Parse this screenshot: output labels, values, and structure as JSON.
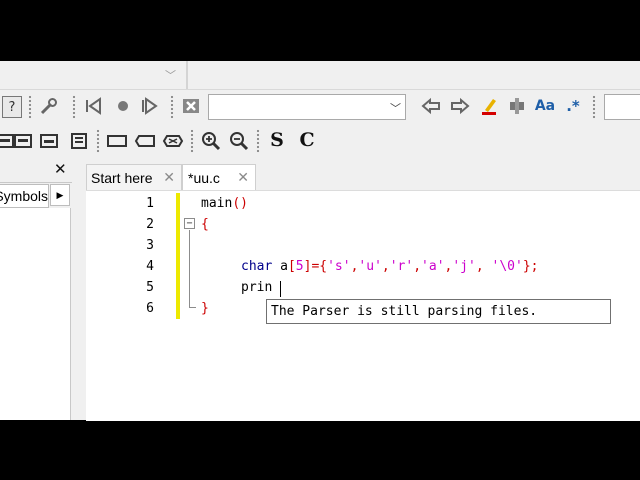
{
  "toolbar": {
    "search_combo_value": "",
    "second_combo_value": "",
    "icons_row1": [
      "help-icon",
      "wrench-icon",
      "prev-bookmark-icon",
      "bookmark-dot-icon",
      "next-bookmark-icon",
      "stop-icon",
      "back-arrow-icon",
      "forward-arrow-icon",
      "highlight-pen-icon",
      "toolbar-tool-icon",
      "match-case-icon",
      "regex-icon"
    ],
    "icons_row2": [
      "block-icon-1",
      "block-icon-2",
      "block-icon-3",
      "block-icon-4",
      "rect-icon-1",
      "rect-icon-2",
      "rect-icon-3",
      "zoom-in-icon",
      "zoom-out-icon",
      "s-icon",
      "c-icon"
    ],
    "match_case_glyph": "Aa",
    "regex_glyph": ".*",
    "s_glyph": "S",
    "c_glyph": "C"
  },
  "left_panel": {
    "close_glyph": "✕",
    "tab_label": "Symbols",
    "scroll_glyph": "▶"
  },
  "tabs": [
    {
      "label": "Start here",
      "close": "✕"
    },
    {
      "label": "*uu.c",
      "close": "✕"
    }
  ],
  "editor": {
    "line_numbers": [
      "1",
      "2",
      "3",
      "4",
      "5",
      "6"
    ],
    "line1_name": "main",
    "line1_parens": "()",
    "line2_brace": "{",
    "line4_keyword": "char",
    "line4_var": " a",
    "line4_open": "[",
    "line4_num": "5",
    "line4_mid": "]={",
    "line4_s1": "'s'",
    "c1": ",",
    "line4_s2": "'u'",
    "c2": ",",
    "line4_s3": "'r'",
    "c3": ",",
    "line4_s4": "'a'",
    "c4": ",",
    "line4_s5": "'j'",
    "c5": ", ",
    "line4_s6": "'\\0'",
    "line4_end": "};",
    "line5_text": "prin",
    "line6_brace": "}",
    "tooltip": "The Parser is still parsing files."
  },
  "colors": {
    "keyword": "#00008b",
    "bracket": "#cc0000",
    "string": "#cc00cc",
    "change_bar": "#ede900"
  }
}
